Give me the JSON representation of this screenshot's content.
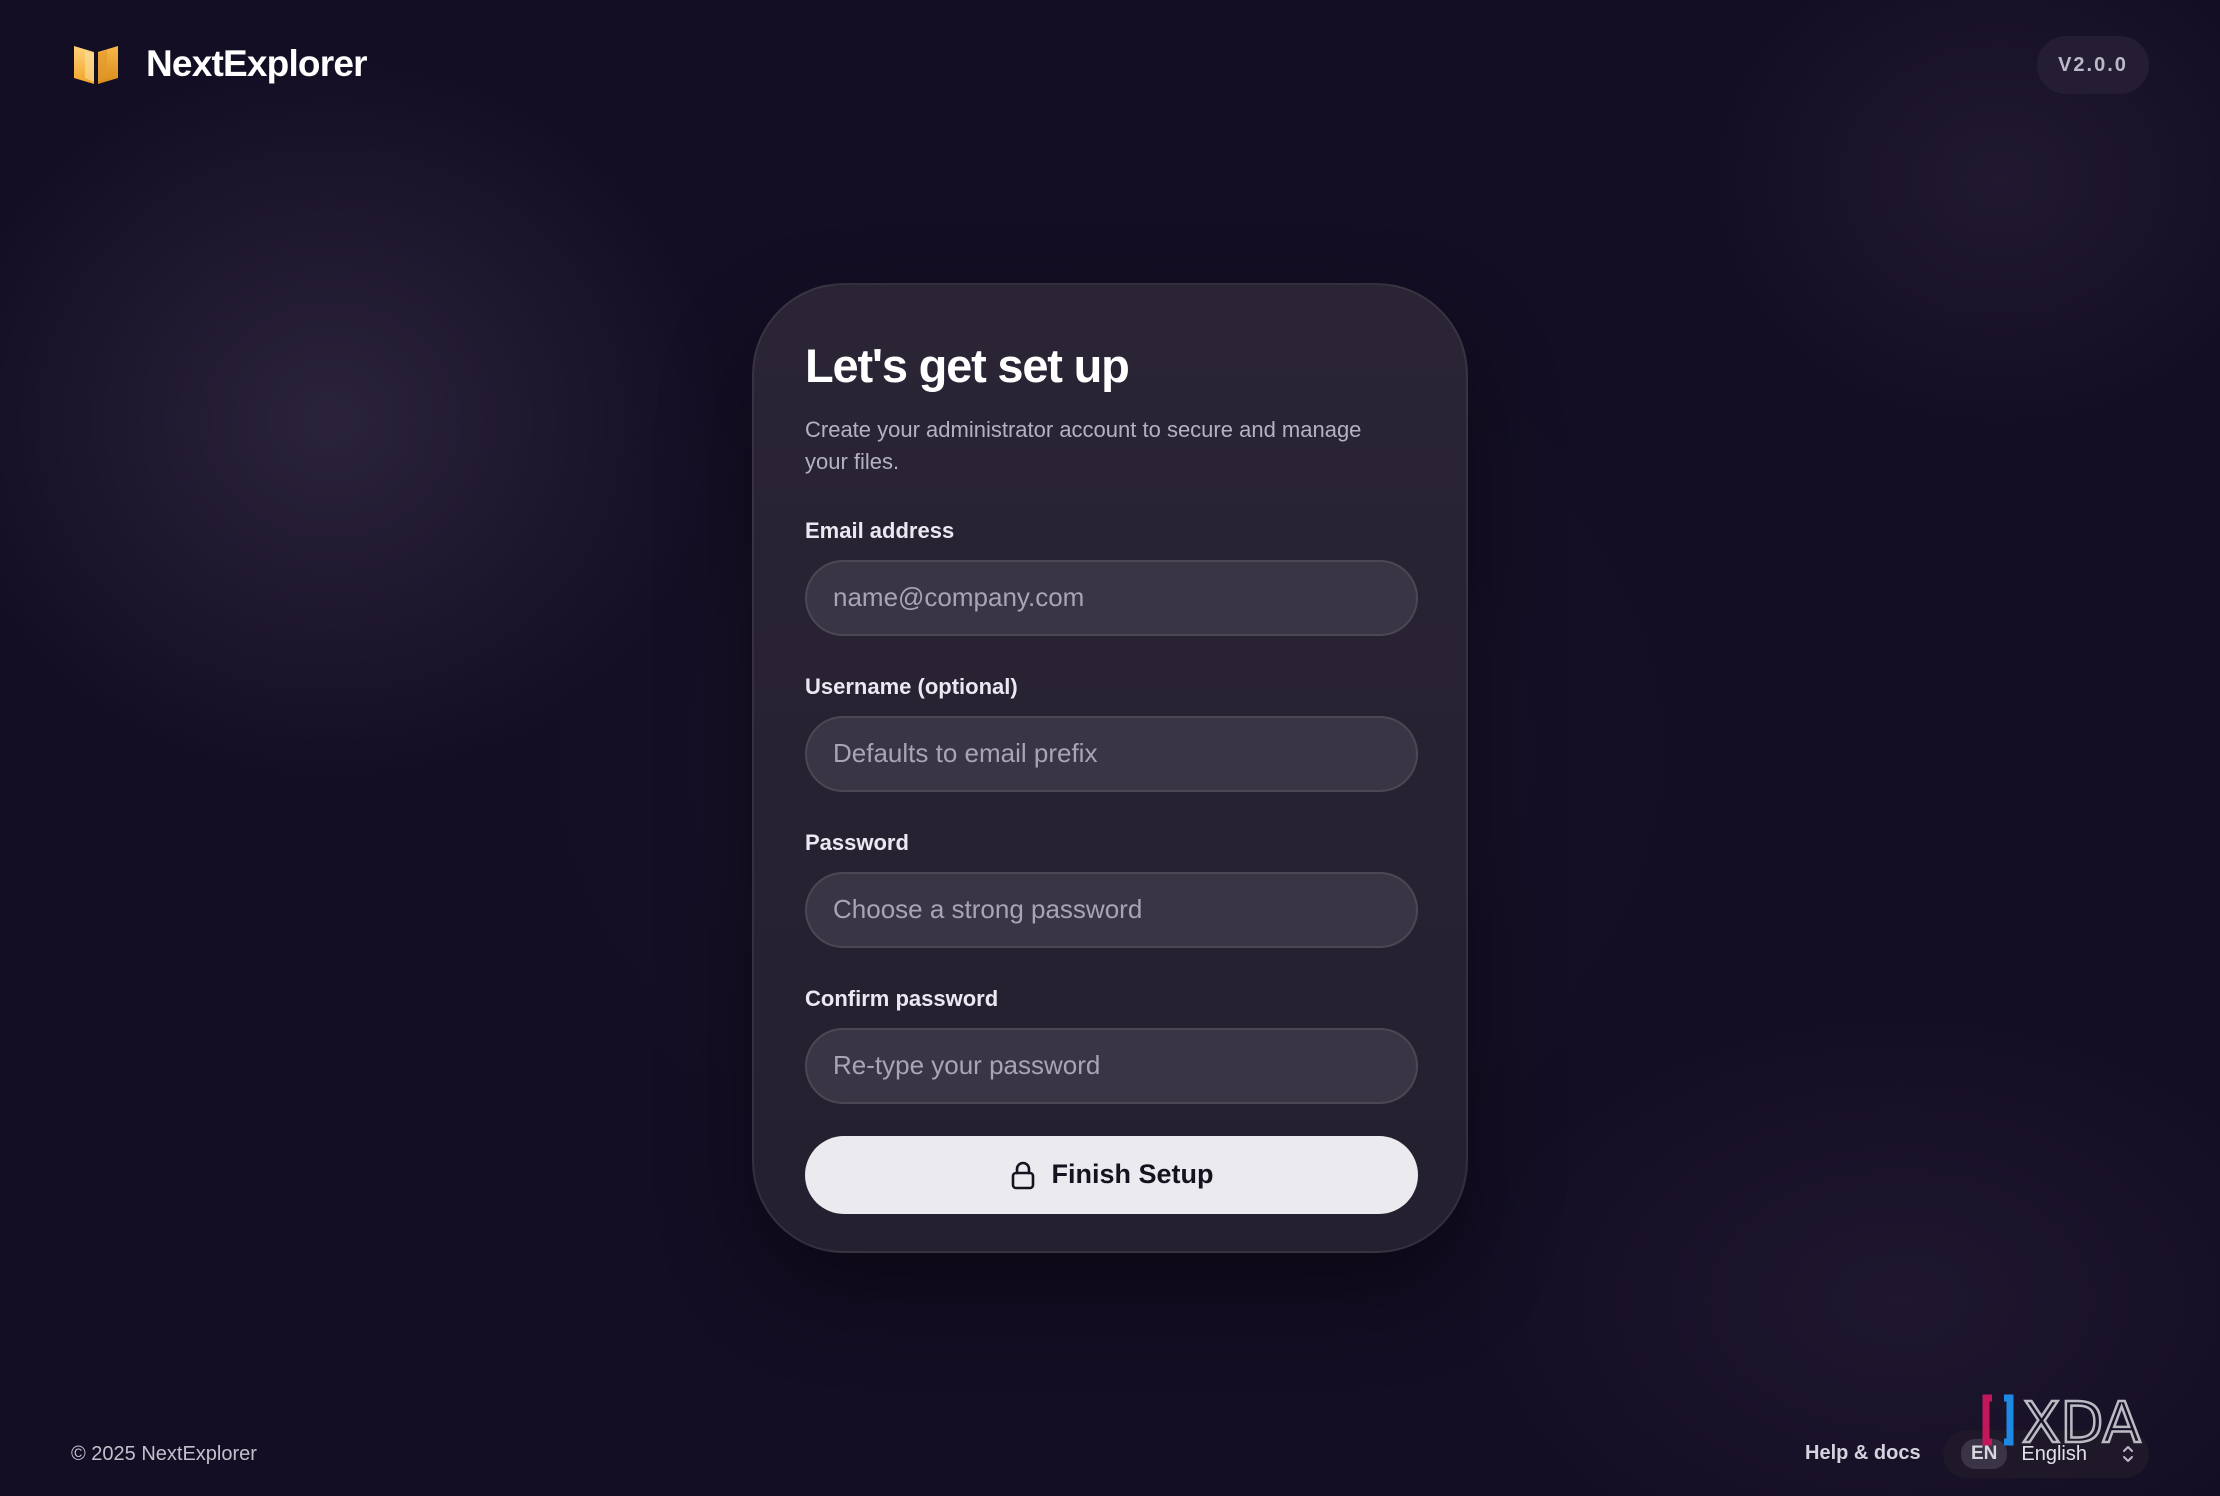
{
  "app": {
    "name": "NextExplorer",
    "version": "V2.0.0",
    "logo_icon": "open-book-icon",
    "accent_color": "#f5b53d"
  },
  "setup_card": {
    "title": "Let's get set up",
    "subtitle": "Create your administrator account to secure and manage your files.",
    "fields": [
      {
        "label": "Email address",
        "placeholder": "name@company.com",
        "value": ""
      },
      {
        "label": "Username (optional)",
        "placeholder": "Defaults to email prefix",
        "value": ""
      },
      {
        "label": "Password",
        "placeholder": "Choose a strong password",
        "value": ""
      },
      {
        "label": "Confirm password",
        "placeholder": "Re-type your password",
        "value": ""
      }
    ],
    "submit": {
      "label": "Finish Setup",
      "icon": "lock-icon"
    }
  },
  "footer": {
    "copyright": "© 2025 NextExplorer",
    "help_link": "Help & docs",
    "language": {
      "code": "EN",
      "selected": "English"
    }
  },
  "watermark": "XDA"
}
